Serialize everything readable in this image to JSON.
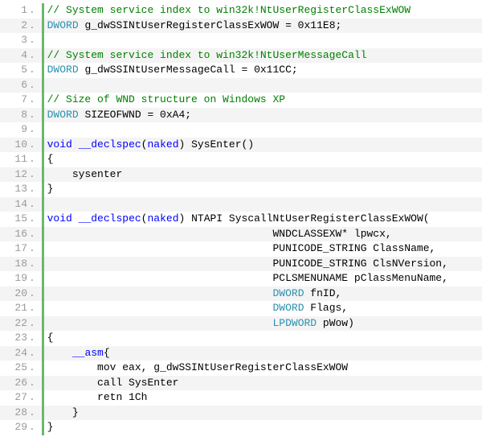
{
  "code": {
    "lines": [
      {
        "n": "1",
        "alt": false,
        "tokens": [
          {
            "cls": "tok-comment",
            "t": "// System service index to win32k!NtUserRegisterClassExWOW"
          }
        ]
      },
      {
        "n": "2",
        "alt": true,
        "tokens": [
          {
            "cls": "tok-type",
            "t": "DWORD"
          },
          {
            "cls": "tok-plain",
            "t": " g_dwSSINtUserRegisterClassExWOW = 0x11E8;"
          }
        ]
      },
      {
        "n": "3",
        "alt": false,
        "tokens": [
          {
            "cls": "tok-plain",
            "t": ""
          }
        ]
      },
      {
        "n": "4",
        "alt": true,
        "tokens": [
          {
            "cls": "tok-comment",
            "t": "// System service index to win32k!NtUserMessageCall"
          }
        ]
      },
      {
        "n": "5",
        "alt": false,
        "tokens": [
          {
            "cls": "tok-type",
            "t": "DWORD"
          },
          {
            "cls": "tok-plain",
            "t": " g_dwSSINtUserMessageCall = 0x11CC;"
          }
        ]
      },
      {
        "n": "6",
        "alt": true,
        "tokens": [
          {
            "cls": "tok-plain",
            "t": ""
          }
        ]
      },
      {
        "n": "7",
        "alt": false,
        "tokens": [
          {
            "cls": "tok-comment",
            "t": "// Size of WND structure on Windows XP"
          }
        ]
      },
      {
        "n": "8",
        "alt": true,
        "tokens": [
          {
            "cls": "tok-type",
            "t": "DWORD"
          },
          {
            "cls": "tok-plain",
            "t": " SIZEOFWND = 0xA4;"
          }
        ]
      },
      {
        "n": "9",
        "alt": false,
        "tokens": [
          {
            "cls": "tok-plain",
            "t": ""
          }
        ]
      },
      {
        "n": "10",
        "alt": true,
        "tokens": [
          {
            "cls": "tok-keyword",
            "t": "void"
          },
          {
            "cls": "tok-plain",
            "t": " "
          },
          {
            "cls": "tok-keyword",
            "t": "__declspec"
          },
          {
            "cls": "tok-plain",
            "t": "("
          },
          {
            "cls": "tok-keyword",
            "t": "naked"
          },
          {
            "cls": "tok-plain",
            "t": ") SysEnter()"
          }
        ]
      },
      {
        "n": "11",
        "alt": false,
        "tokens": [
          {
            "cls": "tok-plain",
            "t": "{"
          }
        ]
      },
      {
        "n": "12",
        "alt": true,
        "tokens": [
          {
            "cls": "tok-plain",
            "t": "    sysenter"
          }
        ]
      },
      {
        "n": "13",
        "alt": false,
        "tokens": [
          {
            "cls": "tok-plain",
            "t": "}"
          }
        ]
      },
      {
        "n": "14",
        "alt": true,
        "tokens": [
          {
            "cls": "tok-plain",
            "t": ""
          }
        ]
      },
      {
        "n": "15",
        "alt": false,
        "tokens": [
          {
            "cls": "tok-keyword",
            "t": "void"
          },
          {
            "cls": "tok-plain",
            "t": " "
          },
          {
            "cls": "tok-keyword",
            "t": "__declspec"
          },
          {
            "cls": "tok-plain",
            "t": "("
          },
          {
            "cls": "tok-keyword",
            "t": "naked"
          },
          {
            "cls": "tok-plain",
            "t": ") NTAPI SyscallNtUserRegisterClassExWOW("
          }
        ]
      },
      {
        "n": "16",
        "alt": true,
        "tokens": [
          {
            "cls": "tok-plain",
            "t": "                                    WNDCLASSEXW* lpwcx,"
          }
        ]
      },
      {
        "n": "17",
        "alt": false,
        "tokens": [
          {
            "cls": "tok-plain",
            "t": "                                    PUNICODE_STRING ClassName,"
          }
        ]
      },
      {
        "n": "18",
        "alt": true,
        "tokens": [
          {
            "cls": "tok-plain",
            "t": "                                    PUNICODE_STRING ClsNVersion,"
          }
        ]
      },
      {
        "n": "19",
        "alt": false,
        "tokens": [
          {
            "cls": "tok-plain",
            "t": "                                    PCLSMENUNAME pClassMenuName,"
          }
        ]
      },
      {
        "n": "20",
        "alt": true,
        "tokens": [
          {
            "cls": "tok-plain",
            "t": "                                    "
          },
          {
            "cls": "tok-type",
            "t": "DWORD"
          },
          {
            "cls": "tok-plain",
            "t": " fnID,"
          }
        ]
      },
      {
        "n": "21",
        "alt": false,
        "tokens": [
          {
            "cls": "tok-plain",
            "t": "                                    "
          },
          {
            "cls": "tok-type",
            "t": "DWORD"
          },
          {
            "cls": "tok-plain",
            "t": " Flags,"
          }
        ]
      },
      {
        "n": "22",
        "alt": true,
        "tokens": [
          {
            "cls": "tok-plain",
            "t": "                                    "
          },
          {
            "cls": "tok-type",
            "t": "LPDWORD"
          },
          {
            "cls": "tok-plain",
            "t": " pWow)"
          }
        ]
      },
      {
        "n": "23",
        "alt": false,
        "tokens": [
          {
            "cls": "tok-plain",
            "t": "{"
          }
        ]
      },
      {
        "n": "24",
        "alt": true,
        "tokens": [
          {
            "cls": "tok-plain",
            "t": "    "
          },
          {
            "cls": "tok-keyword",
            "t": "__asm"
          },
          {
            "cls": "tok-plain",
            "t": "{"
          }
        ]
      },
      {
        "n": "25",
        "alt": false,
        "tokens": [
          {
            "cls": "tok-plain",
            "t": "        mov eax, g_dwSSINtUserRegisterClassExWOW"
          }
        ]
      },
      {
        "n": "26",
        "alt": true,
        "tokens": [
          {
            "cls": "tok-plain",
            "t": "        call SysEnter"
          }
        ]
      },
      {
        "n": "27",
        "alt": false,
        "tokens": [
          {
            "cls": "tok-plain",
            "t": "        retn 1Ch"
          }
        ]
      },
      {
        "n": "28",
        "alt": true,
        "tokens": [
          {
            "cls": "tok-plain",
            "t": "    }"
          }
        ]
      },
      {
        "n": "29",
        "alt": false,
        "tokens": [
          {
            "cls": "tok-plain",
            "t": "}"
          }
        ]
      }
    ]
  }
}
